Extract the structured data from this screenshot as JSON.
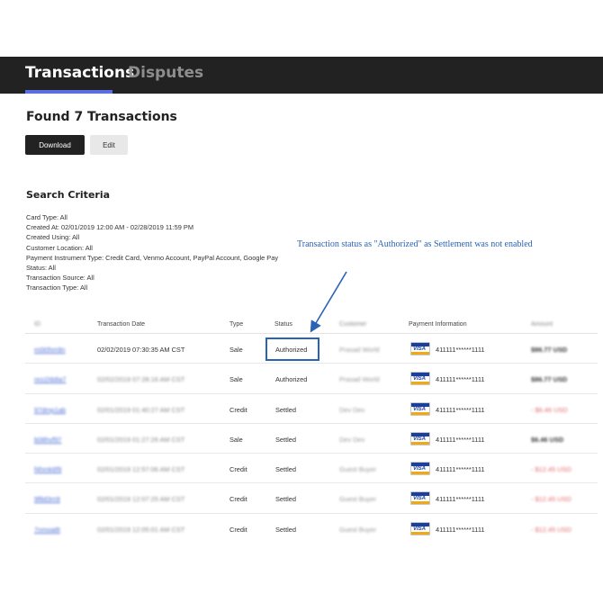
{
  "tabs": [
    {
      "label": "Transactions",
      "active": true
    },
    {
      "label": "Disputes",
      "active": false
    }
  ],
  "header": {
    "title": "Found 7 Transactions"
  },
  "buttons": {
    "download": "Download",
    "edit": "Edit"
  },
  "search_criteria": {
    "title": "Search Criteria",
    "lines": [
      "Card Type: All",
      "Created At: 02/01/2019 12:00 AM - 02/28/2019 11:59 PM",
      "Created Using: All",
      "Customer Location: All",
      "Payment Instrument Type: Credit Card, Venmo Account, PayPal Account, Google Pay",
      "Status: All",
      "Transaction Source: All",
      "Transaction Type: All"
    ]
  },
  "annotation": "Transaction status as \"Authorized\" as Settlement was not enabled",
  "table": {
    "columns": [
      "ID",
      "Transaction Date",
      "Type",
      "Status",
      "Customer",
      "Payment Information",
      "Amount"
    ],
    "rows": [
      {
        "id": "m0i0hm9n",
        "date": "02/02/2019 07:30:35 AM CST",
        "type": "Sale",
        "status": "Authorized",
        "customer": "Prasad World",
        "card_brand": "VISA",
        "card": "411111******1111",
        "amount": "$86.77 USD",
        "amount_style": "dark"
      },
      {
        "id": "nro1hb8a7",
        "date": "02/02/2019 07:28:16 AM CST",
        "type": "Sale",
        "status": "Authorized",
        "customer": "Prasad World",
        "card_brand": "VISA",
        "card": "411111******1111",
        "amount": "$86.77 USD",
        "amount_style": "dark"
      },
      {
        "id": "97dmp1ab",
        "date": "02/01/2019 01:40:27 AM CST",
        "type": "Credit",
        "status": "Settled",
        "customer": "Dev Dev",
        "card_brand": "VISA",
        "card": "411111******1111",
        "amount": "- $6.46 USD",
        "amount_style": "red"
      },
      {
        "id": "b08hvf97",
        "date": "02/01/2019 01:27:26 AM CST",
        "type": "Sale",
        "status": "Settled",
        "customer": "Dev Dev",
        "card_brand": "VISA",
        "card": "411111******1111",
        "amount": "$6.46 USD",
        "amount_style": "dark"
      },
      {
        "id": "f4hmk6f9",
        "date": "02/01/2019 12:57:06 AM CST",
        "type": "Credit",
        "status": "Settled",
        "customer": "Guest Buyer",
        "card_brand": "VISA",
        "card": "411111******1111",
        "amount": "- $12.45 USD",
        "amount_style": "red"
      },
      {
        "id": "9f8d3m9",
        "date": "02/01/2019 12:07:25 AM CST",
        "type": "Credit",
        "status": "Settled",
        "customer": "Guest Buyer",
        "card_brand": "VISA",
        "card": "411111******1111",
        "amount": "- $12.45 USD",
        "amount_style": "red"
      },
      {
        "id": "7nmoa8t",
        "date": "02/01/2019 12:05:01 AM CST",
        "type": "Credit",
        "status": "Settled",
        "customer": "Guest Buyer",
        "card_brand": "VISA",
        "card": "411111******1111",
        "amount": "- $12.45 USD",
        "amount_style": "red"
      }
    ]
  },
  "colors": {
    "topbar": "#222222",
    "tab_underline": "#5b6ee1",
    "annotation": "#2a62b5",
    "link": "#4d6fd6",
    "negative_amount": "#e46a6a"
  },
  "icons": [
    "visa-card-icon",
    "annotation-arrow-icon"
  ]
}
